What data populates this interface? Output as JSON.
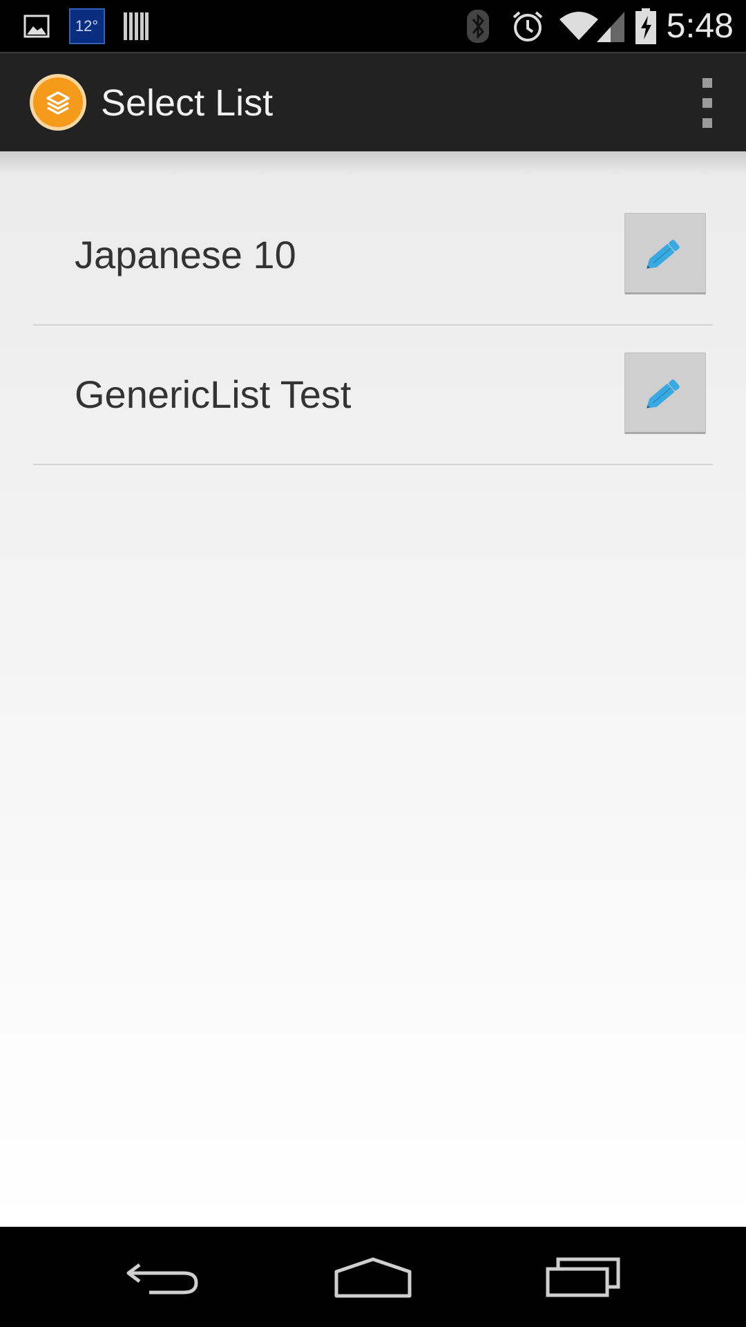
{
  "status_bar": {
    "weather_temp": "12°",
    "time": "5:48",
    "icons": [
      "gallery-icon",
      "weather-icon",
      "barcode-icon",
      "bluetooth-icon",
      "alarm-icon",
      "wifi-icon",
      "signal-icon",
      "battery-charging-icon"
    ]
  },
  "action_bar": {
    "title": "Select List",
    "logo_icon": "layers-icon",
    "overflow_icon": "overflow-menu-icon"
  },
  "lists": [
    {
      "label": "Japanese 10",
      "action_icon": "pencil-icon"
    },
    {
      "label": "GenericList Test",
      "action_icon": "pencil-icon"
    }
  ],
  "nav_bar": {
    "icons": [
      "back-icon",
      "home-icon",
      "recents-icon"
    ]
  },
  "colors": {
    "accent": "#f59a1b",
    "edit_icon": "#39a9e2",
    "action_bar": "#222222",
    "weather_badge": "#0a2e7f"
  }
}
